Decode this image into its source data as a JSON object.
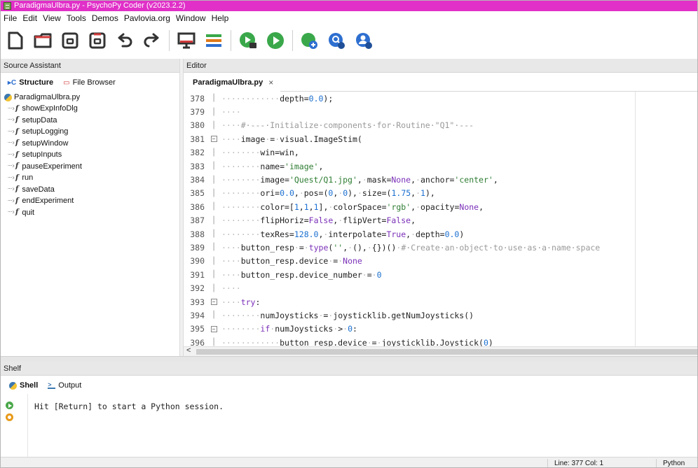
{
  "window": {
    "title": "ParadigmaUlbra.py - PsychoPy Coder (v2023.2.2)"
  },
  "menu": [
    "File",
    "Edit",
    "View",
    "Tools",
    "Demos",
    "Pavlovia.org",
    "Window",
    "Help"
  ],
  "source_assistant": {
    "header": "Source Assistant",
    "tabs": [
      {
        "label": "Structure",
        "icon": "structure-icon",
        "active": true
      },
      {
        "label": "File Browser",
        "icon": "folder-icon",
        "active": false
      }
    ],
    "tree_root": "ParadigmaUlbra.py",
    "tree_items": [
      "showExpInfoDlg",
      "setupData",
      "setupLogging",
      "setupWindow",
      "setupInputs",
      "pauseExperiment",
      "run",
      "saveData",
      "endExperiment",
      "quit"
    ]
  },
  "editor": {
    "header": "Editor",
    "tab_label": "ParadigmaUlbra.py",
    "tab_close": "×",
    "lines": [
      {
        "num": "378",
        "text": "depth=0.0);"
      },
      {
        "num": "379",
        "text": ""
      },
      {
        "num": "380",
        "text": "# --- Initialize components for Routine \"Q1\" ---"
      },
      {
        "num": "381",
        "text": "image = visual.ImageStim("
      },
      {
        "num": "382",
        "text": "win=win,"
      },
      {
        "num": "383",
        "text": "name='image',"
      },
      {
        "num": "384",
        "text": "image='Quest/Q1.jpg', mask=None, anchor='center',"
      },
      {
        "num": "385",
        "text": "ori=0.0, pos=(0, 0), size=(1.75, 1),"
      },
      {
        "num": "386",
        "text": "color=[1,1,1], colorSpace='rgb', opacity=None,"
      },
      {
        "num": "387",
        "text": "flipHoriz=False, flipVert=False,"
      },
      {
        "num": "388",
        "text": "texRes=128.0, interpolate=True, depth=0.0)"
      },
      {
        "num": "389",
        "text": "button_resp = type('', (), {})() # Create an object to use as a name space"
      },
      {
        "num": "390",
        "text": "button_resp.device = None"
      },
      {
        "num": "391",
        "text": "button_resp.device_number = 0"
      },
      {
        "num": "392",
        "text": ""
      },
      {
        "num": "393",
        "text": "try:"
      },
      {
        "num": "394",
        "text": "numJoysticks = joysticklib.getNumJoysticks()"
      },
      {
        "num": "395",
        "text": "if numJoysticks > 0:"
      },
      {
        "num": "396",
        "text": "button_resp.device = joysticklib.Joystick(0)"
      }
    ],
    "scroll_left_arrow": "<"
  },
  "shelf": {
    "header": "Shelf",
    "tabs": [
      {
        "label": "Shell",
        "icon": "python-icon",
        "active": true
      },
      {
        "label": "Output",
        "icon": "output-icon",
        "active": false
      }
    ],
    "shell_message": "Hit [Return] to start a Python session."
  },
  "statusbar": {
    "position": "Line: 377 Col: 1",
    "language": "Python"
  }
}
